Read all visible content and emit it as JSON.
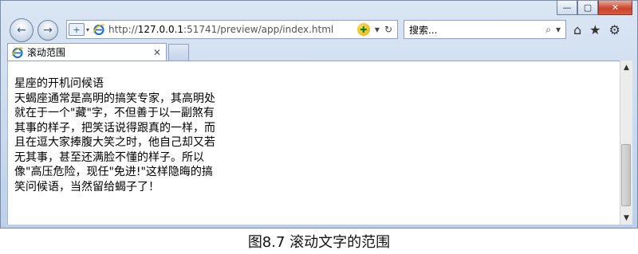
{
  "window": {
    "controls": {
      "minimize": "—",
      "maximize": "▢",
      "close": "✕"
    }
  },
  "nav": {
    "back_icon": "←",
    "forward_icon": "→"
  },
  "address_bar": {
    "security_icon": "+",
    "url_prefix": "http://",
    "url_host": "127.0.0.1",
    "url_rest": ":51741/preview/app/index.html",
    "compat_icon": "✚",
    "dropdown_icon": "▾",
    "refresh_icon": "↻"
  },
  "search": {
    "placeholder": "搜索...",
    "search_icon": "⌕",
    "dropdown_icon": "▾"
  },
  "toolbar_icons": {
    "home": "⌂",
    "favorites": "★",
    "settings": "⚙"
  },
  "tab": {
    "title": "滚动范围",
    "close": "✕"
  },
  "page": {
    "text": "星座的开机问候语\n天蝎座通常是高明的搞笑专家，其高明处\n就在于一个\"藏\"字，不但善于以一副煞有\n其事的样子，把笑话说得跟真的一样，而\n且在逗大家捧腹大笑之时，他自己却又若\n无其事，甚至还满脸不懂的样子。所以\n像\"高压危险，现任\"免进!\"这样隐晦的搞\n笑问候语，当然留给蝎子了！"
  },
  "scrollbar": {
    "up": "▲",
    "down": "▼"
  },
  "caption": "图8.7  滚动文字的范围"
}
